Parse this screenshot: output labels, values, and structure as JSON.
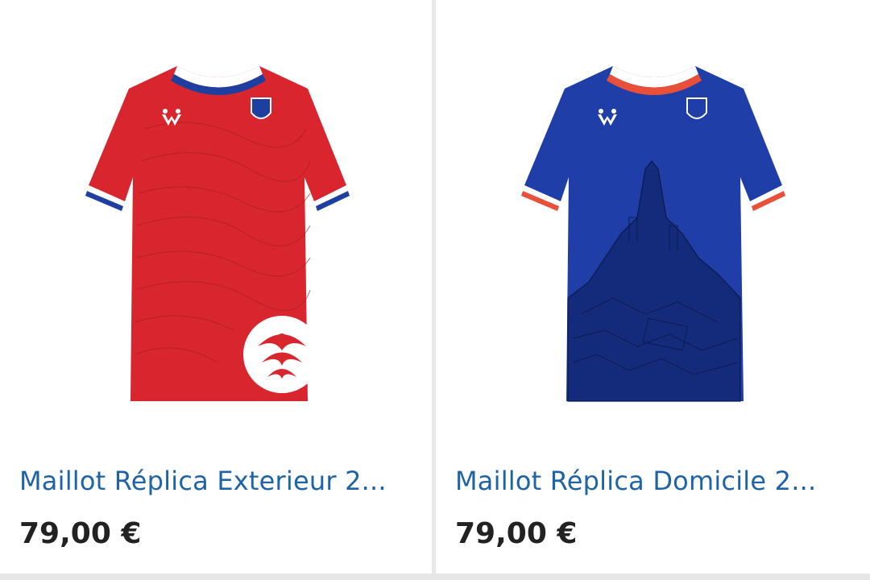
{
  "products": [
    {
      "title": "Maillot Réplica Exterieur 2...",
      "price": "79,00 €",
      "image_icon": "red-away-jersey-image",
      "colors": {
        "body": "#d9262e",
        "collar": "#1e3fa0",
        "accent": "#ffffff"
      }
    },
    {
      "title": "Maillot Réplica Domicile 2...",
      "price": "79,00 €",
      "image_icon": "blue-home-jersey-image",
      "colors": {
        "body": "#1f3ea8",
        "collar": "#e8503a",
        "accent": "#ffffff"
      }
    }
  ],
  "theme": {
    "title_color": "#1e63a6",
    "price_color": "#222222",
    "background": "#ffffff",
    "divider": "#e6e6e6"
  }
}
